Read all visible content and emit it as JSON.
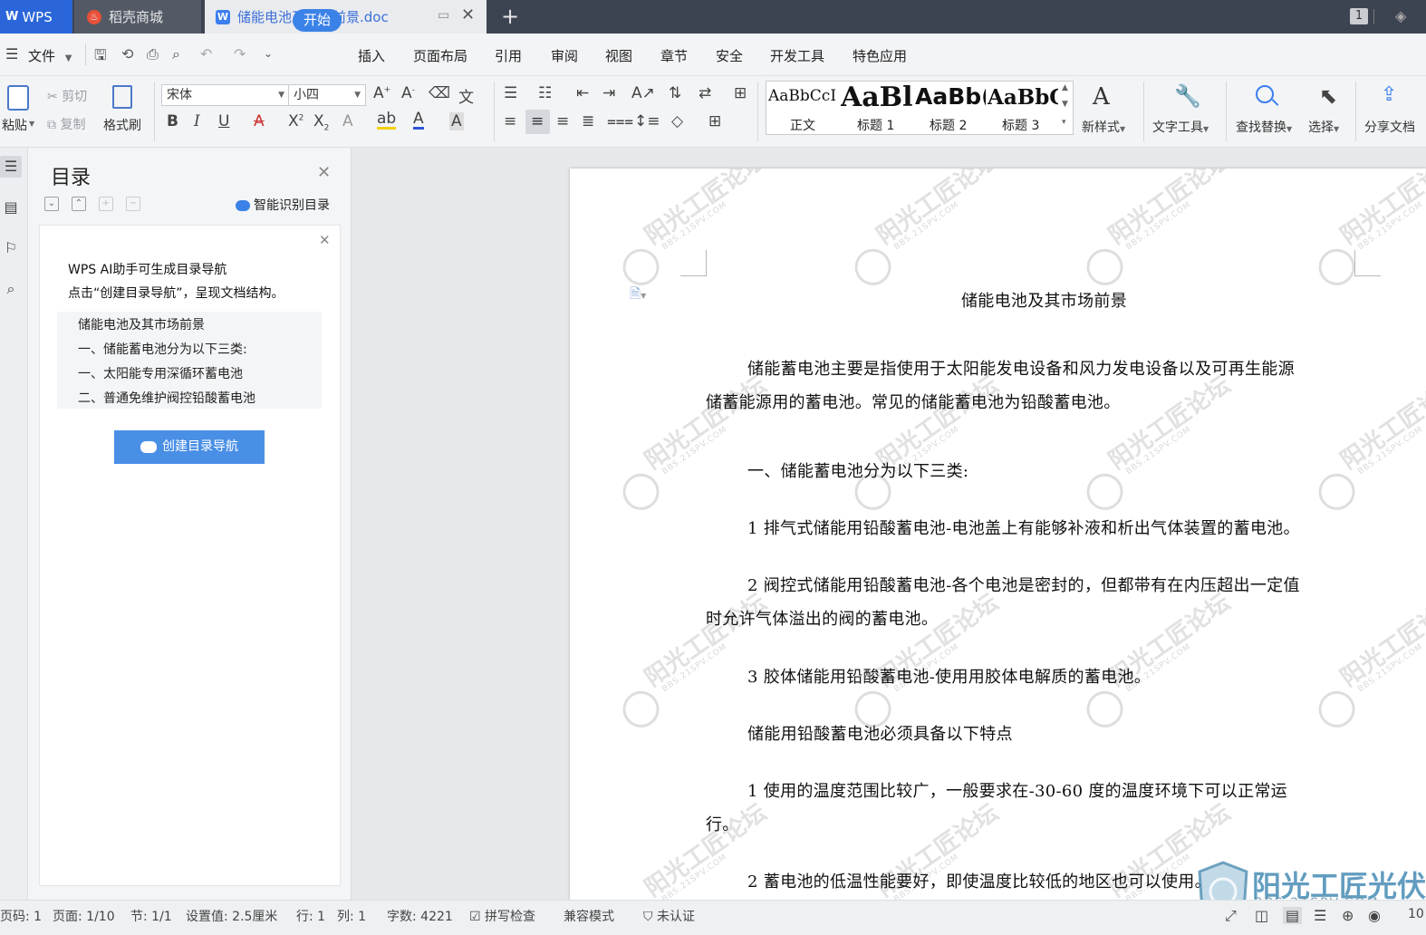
{
  "titlebar": {
    "tabs": [
      {
        "label": "WPS"
      },
      {
        "label": "稻壳商城"
      },
      {
        "label": "储能电池及市场前景.doc"
      }
    ],
    "new_tab": "+",
    "window_count": "1"
  },
  "menubar": {
    "file_label": "文件",
    "items": [
      "开始",
      "插入",
      "页面布局",
      "引用",
      "审阅",
      "视图",
      "章节",
      "安全",
      "开发工具",
      "特色应用"
    ]
  },
  "ribbon": {
    "paste": "粘贴",
    "cut": "剪切",
    "copy": "复制",
    "format_painter": "格式刷",
    "font_name": "宋体",
    "font_size": "小四",
    "styles": [
      {
        "sample": "AaBbCcI",
        "name": "正文"
      },
      {
        "sample": "AaBl",
        "name": "标题 1"
      },
      {
        "sample": "AaBb(",
        "name": "标题 2"
      },
      {
        "sample": "AaBbC",
        "name": "标题 3"
      }
    ],
    "new_style": "新样式",
    "text_tools": "文字工具",
    "find_replace": "查找替换",
    "select": "选择",
    "share_doc": "分享文档"
  },
  "toc_panel": {
    "title": "目录",
    "smart_toc": "智能识别目录",
    "ai_line1": "WPS AI助手可生成目录导航",
    "ai_line2": "点击“创建目录导航”，呈现文档结构。",
    "outline": [
      "储能电池及其市场前景",
      "一、储能蓄电池分为以下三类:",
      "一、太阳能专用深循环蓄电池",
      "二、普通免维护阀控铅酸蓄电池"
    ],
    "create_button": "创建目录导航"
  },
  "document": {
    "title": "储能电池及其市场前景",
    "paragraphs": [
      "储能蓄电池主要是指使用于太阳能发电设备和风力发电设备以及可再生能源",
      "储蓄能源用的蓄电池。常见的储能蓄电池为铅酸蓄电池。",
      "一、储能蓄电池分为以下三类:",
      "1 排气式储能用铅酸蓄电池-电池盖上有能够补液和析出气体装置的蓄电池。",
      "2 阀控式储能用铅酸蓄电池-各个电池是密封的，但都带有在内压超出一定值",
      "时允许气体溢出的阀的蓄电池。",
      "3 胶体储能用铅酸蓄电池-使用用胶体电解质的蓄电池。",
      "储能用铅酸蓄电池必须具备以下特点",
      "1 使用的温度范围比较广，一般要求在-30-60 度的温度环境下可以正常运",
      "行。",
      "2 蓄电池的低温性能要好，即使温度比较低的地区也可以使用。"
    ],
    "watermark_text": "阳光工匠论坛",
    "watermark_url": "BBS.21SPV.COM",
    "logo_text": "阳光工匠光伏论坛",
    "logo_url": "BBS.21SPV.COM"
  },
  "statusbar": {
    "page_code": "页码: 1",
    "page": "页面: 1/10",
    "section": "节: 1/1",
    "setting": "设置值: 2.5厘米",
    "row": "行: 1",
    "col": "列: 1",
    "word_count": "字数: 4221",
    "spell_check": "拼写检查",
    "compat_mode": "兼容模式",
    "unverified": "未认证",
    "zoom": "10"
  }
}
